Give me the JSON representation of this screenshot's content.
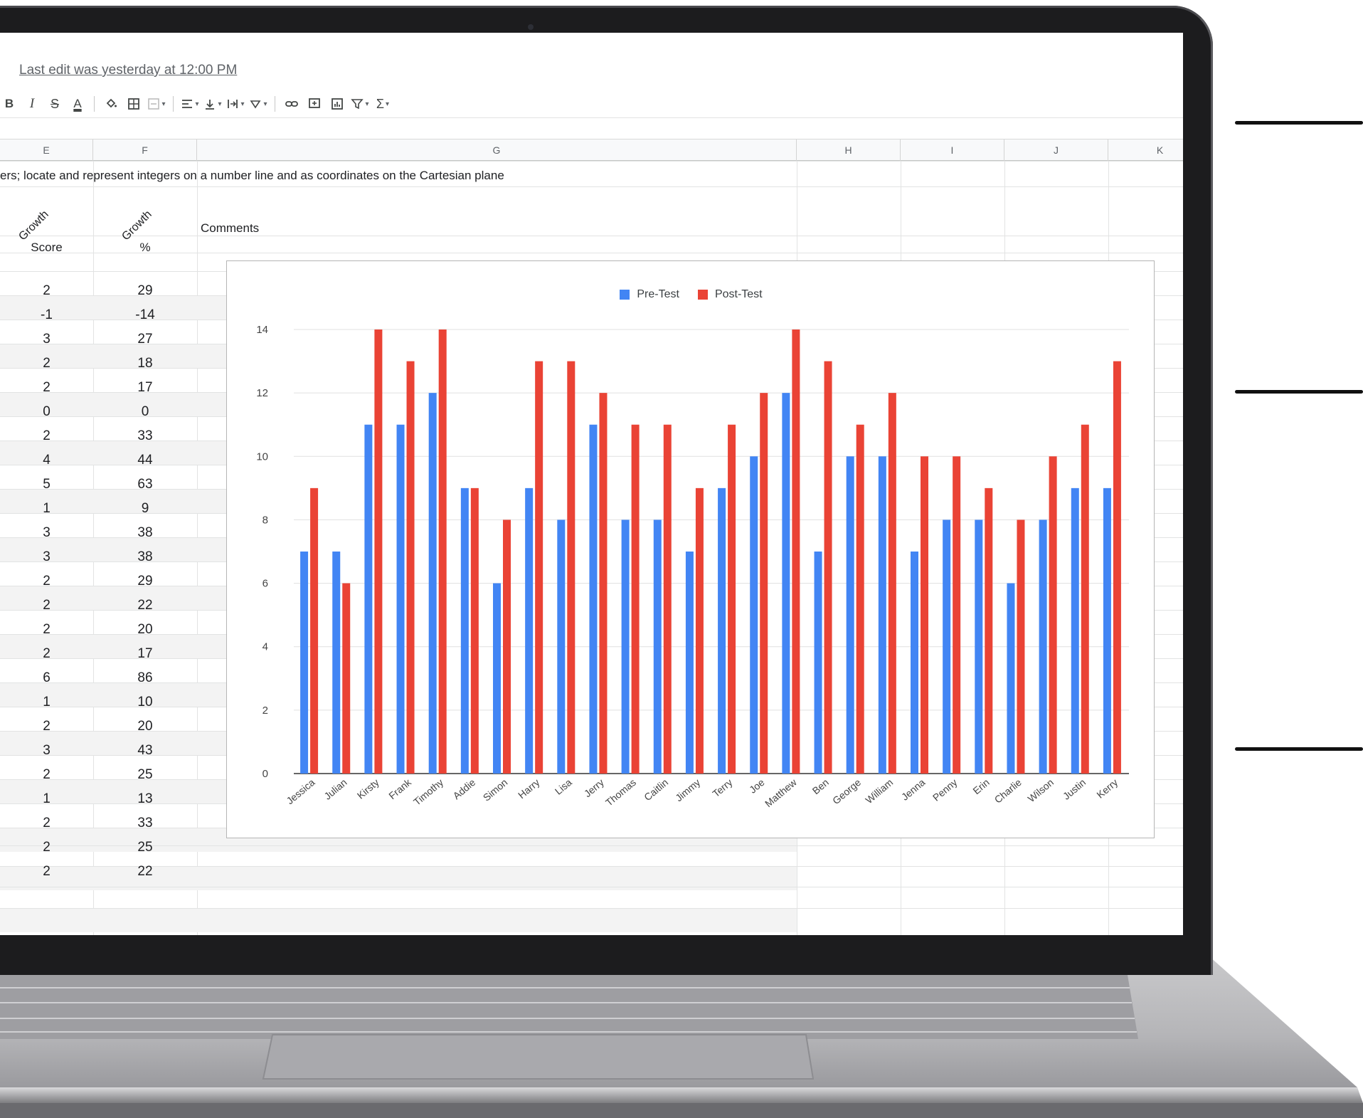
{
  "doc": {
    "last_edit": "Last edit was yesterday at 12:00 PM",
    "description_row": "ers; locate and represent integers on a number line and as coordinates on the Cartesian plane"
  },
  "toolbar": {
    "items": [
      "bold-button",
      "italic-button",
      "strikethrough-button",
      "text-color-button",
      "fill-color-button",
      "borders-button",
      "merge-cells-button",
      "horizontal-align-button",
      "vertical-align-button",
      "text-wrapping-button",
      "text-rotation-button",
      "insert-link-button",
      "insert-comment-button",
      "insert-chart-button",
      "filter-button",
      "functions-button"
    ],
    "labels": {
      "bold": "B",
      "italic": "I",
      "strike": "S",
      "textcolor": "A",
      "functions": "Σ"
    }
  },
  "columns": [
    "E",
    "F",
    "G",
    "H",
    "I",
    "J",
    "K"
  ],
  "headers": {
    "e_rotated": "Growth",
    "f_rotated": "Growth",
    "g": "Comments",
    "e_sub": "Score",
    "f_sub": "%"
  },
  "table": {
    "growth_score": [
      "2",
      "-1",
      "3",
      "2",
      "2",
      "0",
      "2",
      "4",
      "5",
      "1",
      "3",
      "3",
      "2",
      "2",
      "2",
      "2",
      "6",
      "1",
      "2",
      "3",
      "2",
      "1",
      "2",
      "2",
      "2"
    ],
    "growth_pct": [
      "29",
      "-14",
      "27",
      "18",
      "17",
      "0",
      "33",
      "44",
      "63",
      "9",
      "38",
      "38",
      "29",
      "22",
      "20",
      "17",
      "86",
      "10",
      "20",
      "43",
      "25",
      "13",
      "33",
      "25",
      "22"
    ]
  },
  "chart_data": {
    "type": "bar",
    "title": "",
    "xlabel": "",
    "ylabel": "",
    "ylim": [
      0,
      14
    ],
    "yticks": [
      0,
      2,
      4,
      6,
      8,
      10,
      12,
      14
    ],
    "grid": true,
    "legend_position": "top",
    "categories": [
      "Jessica",
      "Julian",
      "Kirsty",
      "Frank",
      "Timothy",
      "Addie",
      "Simon",
      "Harry",
      "Lisa",
      "Jerry",
      "Thomas",
      "Caitlin",
      "Jimmy",
      "Terry",
      "Joe",
      "Matthew",
      "Ben",
      "George",
      "William",
      "Jenna",
      "Penny",
      "Erin",
      "Charlie",
      "Wilson",
      "Justin",
      "Kerry"
    ],
    "series": [
      {
        "name": "Pre-Test",
        "color": "#4285f4",
        "values": [
          7,
          7,
          11,
          11,
          12,
          9,
          6,
          9,
          8,
          11,
          8,
          8,
          7,
          9,
          10,
          12,
          7,
          10,
          10,
          7,
          8,
          8,
          6,
          8,
          9,
          9
        ]
      },
      {
        "name": "Post-Test",
        "color": "#ea4335",
        "values": [
          9,
          6,
          14,
          13,
          14,
          9,
          8,
          13,
          13,
          12,
          11,
          11,
          9,
          11,
          12,
          14,
          13,
          11,
          12,
          10,
          10,
          9,
          8,
          10,
          11,
          13
        ]
      }
    ]
  }
}
